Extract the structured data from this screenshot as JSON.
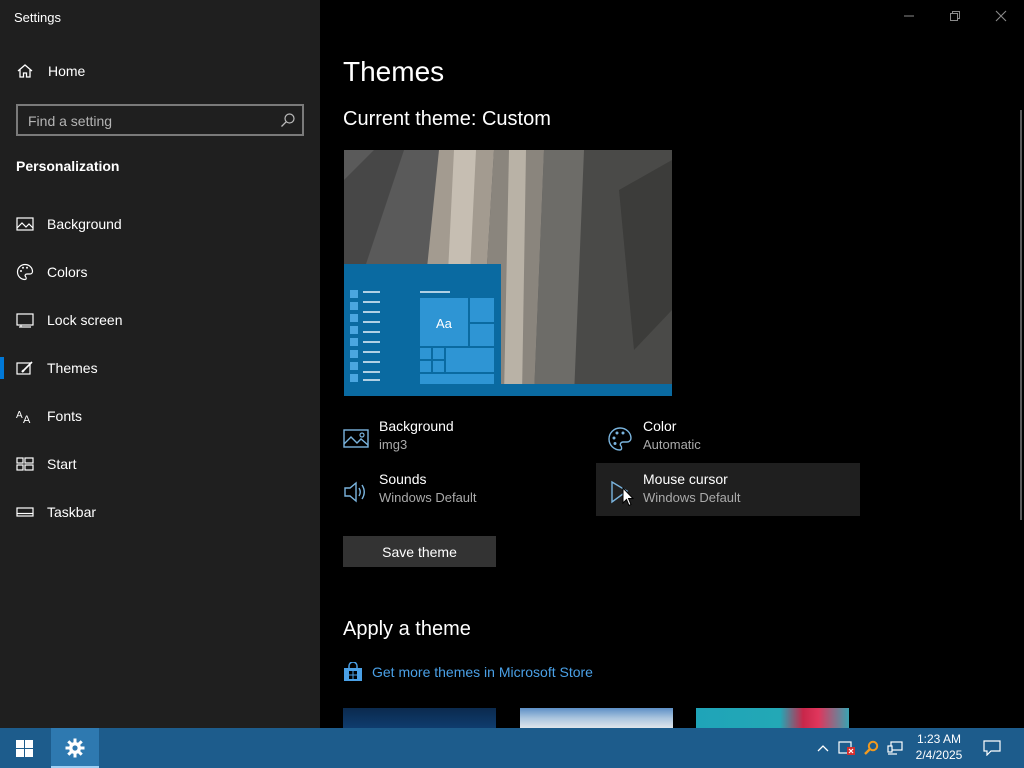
{
  "window": {
    "title": "Settings"
  },
  "sidebar": {
    "home_label": "Home",
    "search_placeholder": "Find a setting",
    "section_title": "Personalization",
    "items": [
      {
        "label": "Background",
        "icon": "picture-icon"
      },
      {
        "label": "Colors",
        "icon": "palette-icon"
      },
      {
        "label": "Lock screen",
        "icon": "lock-screen-icon"
      },
      {
        "label": "Themes",
        "icon": "brush-icon",
        "active": true
      },
      {
        "label": "Fonts",
        "icon": "font-icon"
      },
      {
        "label": "Start",
        "icon": "start-icon"
      },
      {
        "label": "Taskbar",
        "icon": "taskbar-icon"
      }
    ]
  },
  "main": {
    "title": "Themes",
    "current_theme": "Current theme: Custom",
    "preview_tile_text": "Aa",
    "properties": [
      {
        "label": "Background",
        "value": "img3",
        "icon": "picture-icon"
      },
      {
        "label": "Color",
        "value": "Automatic",
        "icon": "palette-icon"
      },
      {
        "label": "Sounds",
        "value": "Windows Default",
        "icon": "speaker-icon"
      },
      {
        "label": "Mouse cursor",
        "value": "Windows Default",
        "icon": "cursor-icon"
      }
    ],
    "save_button": "Save theme",
    "apply_title": "Apply a theme",
    "store_link": "Get more themes in Microsoft Store"
  },
  "taskbar": {
    "time": "1:23 AM",
    "date": "2/4/2025"
  },
  "colors": {
    "accent": "#0078d7",
    "link": "#4aa0e6",
    "taskbar": "#1d5c8c",
    "sidebar": "#1f1f1f"
  }
}
